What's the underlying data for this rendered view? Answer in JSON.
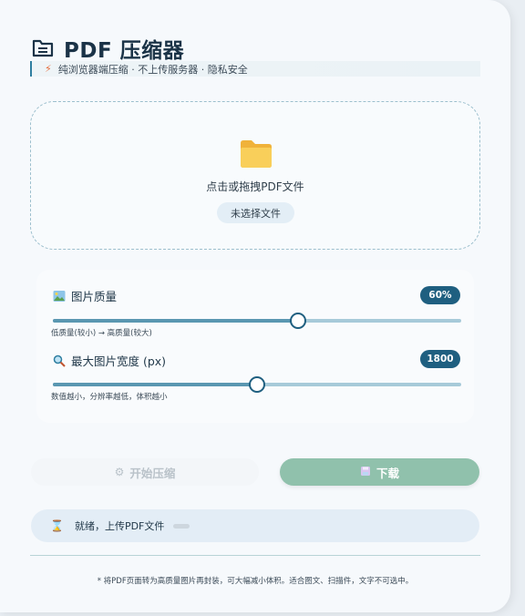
{
  "header": {
    "title": "PDF 压缩器",
    "icon": "document-icon"
  },
  "subtitle": {
    "icon": "bolt-icon",
    "text": "纯浏览器端压缩 · 不上传服务器 · 隐私安全"
  },
  "dropzone": {
    "icon": "folder-icon",
    "hint": "点击或拖拽PDF文件",
    "file_button": "未选择文件"
  },
  "settings": {
    "quality": {
      "icon": "image-icon",
      "label": "图片质量",
      "value_label": "60%",
      "value": 0.6,
      "help": "低质量(较小) → 高质量(较大)"
    },
    "max_width": {
      "icon": "magnifier-icon",
      "label": "最大图片宽度 (px)",
      "value_label": "1800",
      "value": 0.5,
      "help": "数值越小，分辨率越低，体积越小"
    }
  },
  "actions": {
    "start": {
      "icon": "gear-icon",
      "label": "开始压缩"
    },
    "download": {
      "icon": "save-icon",
      "label": "下载"
    }
  },
  "status": {
    "icon": "hourglass-icon",
    "text": "就绪，上传PDF文件",
    "progress": 0
  },
  "footnote": "* 将PDF页面转为高质量图片再封装，可大幅减小体积。适合图文、扫描件，文字不可选中。",
  "colors": {
    "accent": "#1f5f80",
    "download": "#90c1ac",
    "track": "#a7cad9"
  }
}
